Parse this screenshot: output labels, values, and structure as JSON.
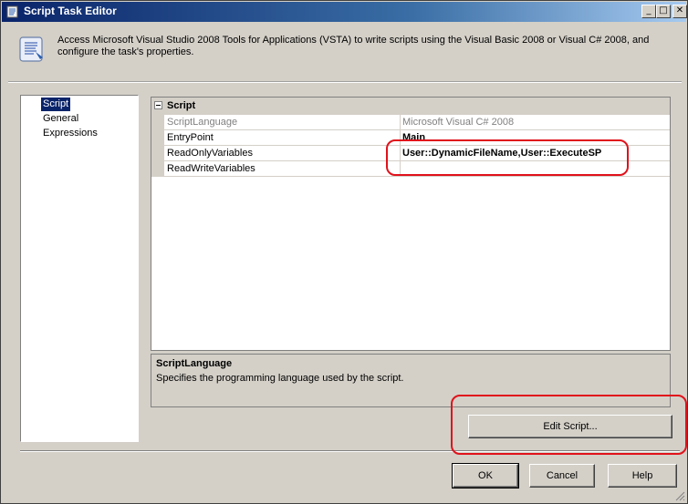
{
  "window": {
    "title": "Script Task Editor",
    "controls": {
      "minimize": "_",
      "maximize": "□",
      "close": "✕"
    }
  },
  "header": {
    "description": "Access Microsoft Visual Studio 2008 Tools for Applications (VSTA) to write scripts using the Visual Basic 2008 or Visual C# 2008, and configure the task's properties."
  },
  "nav": {
    "items": [
      {
        "label": "Script",
        "selected": true
      },
      {
        "label": "General",
        "selected": false
      },
      {
        "label": "Expressions",
        "selected": false
      }
    ]
  },
  "grid": {
    "category": "Script",
    "rows": [
      {
        "name": "ScriptLanguage",
        "value": "Microsoft Visual C# 2008",
        "disabled": true,
        "bold": false
      },
      {
        "name": "EntryPoint",
        "value": "Main",
        "disabled": false,
        "bold": true
      },
      {
        "name": "ReadOnlyVariables",
        "value": "User::DynamicFileName,User::ExecuteSP",
        "disabled": false,
        "bold": true
      },
      {
        "name": "ReadWriteVariables",
        "value": "",
        "disabled": false,
        "bold": false
      }
    ]
  },
  "description_panel": {
    "title": "ScriptLanguage",
    "text": "Specifies the programming language used by the script."
  },
  "buttons": {
    "edit_script": "Edit Script...",
    "ok": "OK",
    "cancel": "Cancel",
    "help": "Help"
  },
  "colors": {
    "annotation": "#e0121b",
    "selection": "#0a246a",
    "titlebar": "#0a246a"
  }
}
